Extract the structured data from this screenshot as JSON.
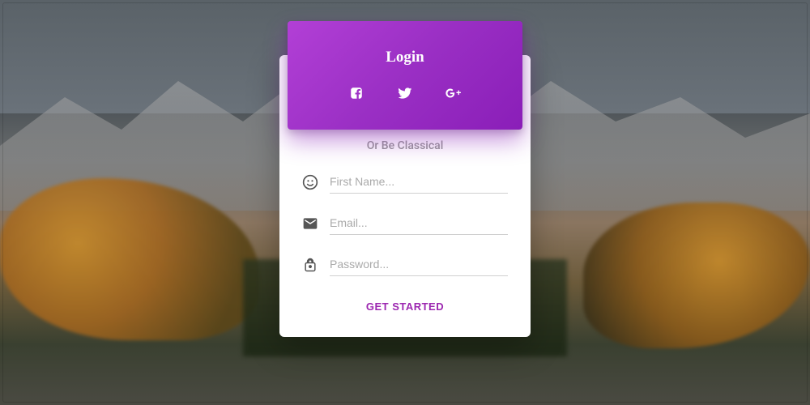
{
  "header": {
    "title": "Login",
    "social": {
      "facebook": "facebook-icon",
      "twitter": "twitter-icon",
      "google": "googleplus-icon"
    }
  },
  "form": {
    "dividerText": "Or Be Classical",
    "fields": {
      "firstName": {
        "placeholder": "First Name..."
      },
      "email": {
        "placeholder": "Email..."
      },
      "password": {
        "placeholder": "Password..."
      }
    },
    "submitLabel": "GET STARTED"
  },
  "colors": {
    "accent": "#9c27b0",
    "headerGradientStart": "#b23fd6",
    "headerGradientEnd": "#8a1eb8"
  }
}
